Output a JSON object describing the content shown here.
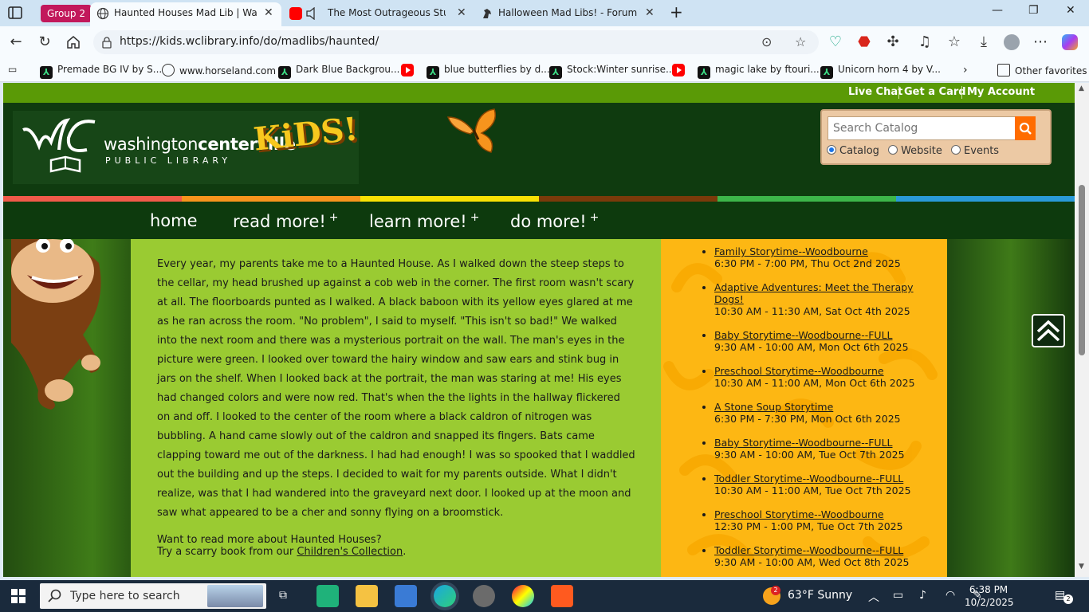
{
  "browser": {
    "tab_group_label": "Group 2",
    "tabs": [
      {
        "title": "Haunted Houses Mad Lib | Washi"
      },
      {
        "title": "The Most Outrageous Stude"
      },
      {
        "title": "Halloween Mad Libs! - Forum Top"
      }
    ],
    "url": "https://kids.wclibrary.info/do/madlibs/haunted/",
    "bookmarks": [
      "Premade BG IV by S...",
      "www.horseland.com",
      "Dark Blue Backgrou...",
      "blue butterflies by d...",
      "Stock:Winter sunrise...",
      "magic lake by ftouri...",
      "Unicorn horn 4 by V..."
    ],
    "other_favorites": "Other favorites"
  },
  "site": {
    "util_links": [
      "Live Chat",
      "Get a Card",
      "My Account"
    ],
    "logo_line1_a": "washington",
    "logo_line1_b": "centerville",
    "logo_line2": "PUBLIC LIBRARY",
    "logo_kids": "KiDS!",
    "search_placeholder": "Search Catalog",
    "search_options": [
      "Catalog",
      "Website",
      "Events"
    ],
    "nav": [
      "home",
      "read more!",
      "learn more!",
      "do more!"
    ],
    "nav_plus": "+",
    "stripe_colors": [
      "#f15a4a",
      "#f7941d",
      "#f9e104",
      "#7a3a0a",
      "#3db54a",
      "#2a9ad8"
    ]
  },
  "story": {
    "text": "Every year, my parents take me to a Haunted House. As I walked down the steep steps to the cellar, my head brushed up against a cob web in the corner. The first room wasn't scary at all. The floorboards punted as I walked. A black baboon with its yellow eyes glared at me as he ran across the room. \"No problem\", I said to myself. \"This isn't so bad!\" We walked into the next room and there was a mysterious portrait on the wall. The man's eyes in the picture were green. I looked over toward the hairy window and saw ears and stink bug in jars on the shelf. When I looked back at the portrait, the man was staring at me! His eyes had changed colors and were now red. That's when the the lights in the hallway flickered on and off. I looked to the center of the room where a black caldron of nitrogen was bubbling. A hand came slowly out of the caldron and snapped its fingers. Bats came clapping toward me out of the darkness. I had had enough! I was so spooked that I waddled out the building and up the steps. I decided to wait for my parents outside. What I didn't realize, was that I had wandered into the graveyard next door. I looked up at the moon and saw what appeared to be a cher and sonny flying on a broomstick.",
    "more_line1": "Want to read more about Haunted Houses?",
    "more_line2_prefix": "Try a scarry book from our ",
    "more_link": "Children's Collection",
    "more_suffix": "."
  },
  "events": [
    {
      "title": "Family Storytime--Woodbourne",
      "when": "6:30 PM - 7:00 PM, Thu Oct 2nd 2025"
    },
    {
      "title": "Adaptive Adventures: Meet the Therapy Dogs!",
      "when": "10:30 AM - 11:30 AM, Sat Oct 4th 2025"
    },
    {
      "title": "Baby Storytime--Woodbourne--FULL",
      "when": "9:30 AM - 10:00 AM, Mon Oct 6th 2025"
    },
    {
      "title": "Preschool Storytime--Woodbourne",
      "when": "10:30 AM - 11:00 AM, Mon Oct 6th 2025"
    },
    {
      "title": "A Stone Soup Storytime",
      "when": "6:30 PM - 7:30 PM, Mon Oct 6th 2025"
    },
    {
      "title": "Baby Storytime--Woodbourne--FULL",
      "when": "9:30 AM - 10:00 AM, Tue Oct 7th 2025"
    },
    {
      "title": "Toddler Storytime--Woodbourne--FULL",
      "when": "10:30 AM - 11:00 AM, Tue Oct 7th 2025"
    },
    {
      "title": "Preschool Storytime--Woodbourne",
      "when": "12:30 PM - 1:00 PM, Tue Oct 7th 2025"
    },
    {
      "title": "Toddler Storytime--Woodbourne--FULL",
      "when": "9:30 AM - 10:00 AM, Wed Oct 8th 2025"
    }
  ],
  "taskbar": {
    "search_placeholder": "Type here to search",
    "weather": "63°F  Sunny",
    "weather_badge": "2",
    "time": "6:38 PM",
    "date": "10/2/2025",
    "notifications": "2"
  }
}
